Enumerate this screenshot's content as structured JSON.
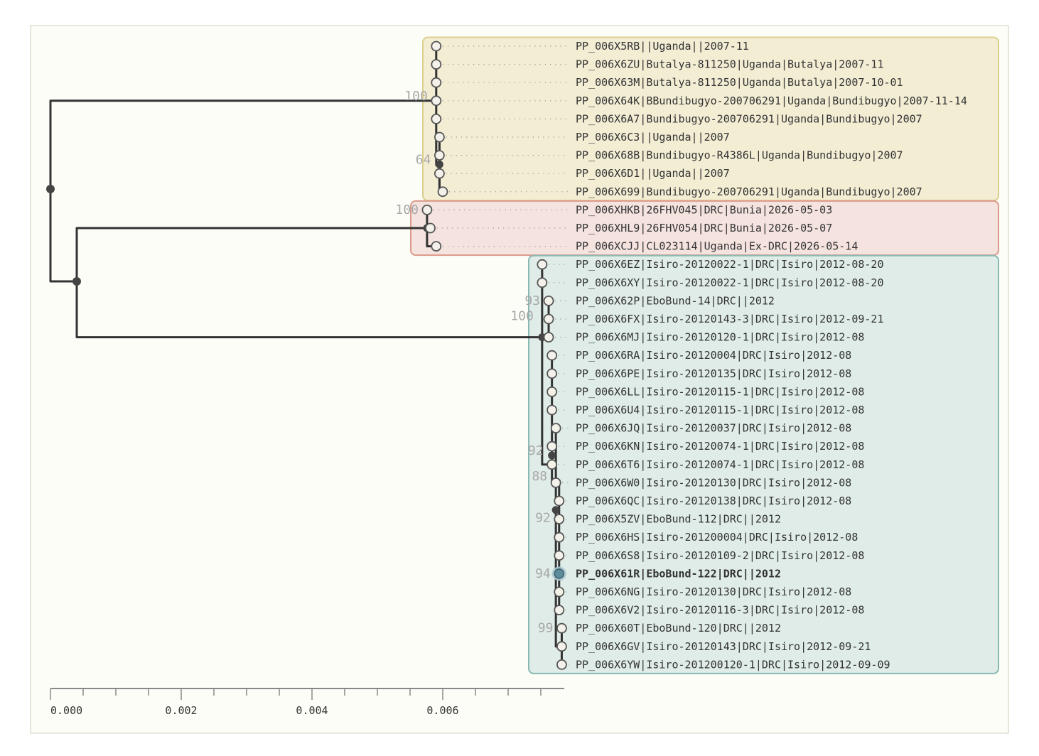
{
  "chart_data": {
    "type": "phylogenetic_tree",
    "axis": {
      "range": [
        0,
        0.0078
      ],
      "ticks": [
        {
          "value": 0.0,
          "label": "0.000"
        },
        {
          "value": 0.002,
          "label": "0.002"
        },
        {
          "value": 0.004,
          "label": "0.004"
        },
        {
          "value": 0.006,
          "label": "0.006"
        }
      ],
      "minor_step": 0.0005
    },
    "clades": [
      {
        "id": "uganda-2007",
        "color": "#f3edd4",
        "border": "#dccf8e"
      },
      {
        "id": "drc-2026",
        "color": "#f4e3df",
        "border": "#dc998a"
      },
      {
        "id": "drc-2012",
        "color": "#dfece8",
        "border": "#8ab8b2"
      }
    ],
    "tips": [
      {
        "label": "PP_006X5RB||Uganda||2007-11",
        "x": 0.0059
      },
      {
        "label": "PP_006X6ZU|Butalya-811250|Uganda|Butalya|2007-11",
        "x": 0.0059
      },
      {
        "label": "PP_006X63M|Butalya-811250|Uganda|Butalya|2007-10-01",
        "x": 0.0059
      },
      {
        "label": "PP_006X64K|BBundibugyo-200706291|Uganda|Bundibugyo|2007-11-14",
        "x": 0.0059
      },
      {
        "label": "PP_006X6A7|Bundibugyo-200706291|Uganda|Bundibugyo|2007",
        "x": 0.0059
      },
      {
        "label": "PP_006X6C3||Uganda||2007",
        "x": 0.00595
      },
      {
        "label": "PP_006X68B|Bundibugyo-R4386L|Uganda|Bundibugyo|2007",
        "x": 0.00595
      },
      {
        "label": "PP_006X6D1||Uganda||2007",
        "x": 0.00595
      },
      {
        "label": "PP_006X699|Bundibugyo-200706291|Uganda|Bundibugyo|2007",
        "x": 0.006
      },
      {
        "label": "PP_006XHKB|26FHV045|DRC|Bunia|2026-05-03",
        "x": 0.00576
      },
      {
        "label": "PP_006XHL9|26FHV054|DRC|Bunia|2026-05-07",
        "x": 0.00581
      },
      {
        "label": "PP_006XCJJ|CL023114|Uganda|Ex-DRC|2026-05-14",
        "x": 0.0059
      },
      {
        "label": "PP_006X6EZ|Isiro-20120022-1|DRC|Isiro|2012-08-20",
        "x": 0.00752
      },
      {
        "label": "PP_006X6XY|Isiro-20120022-1|DRC|Isiro|2012-08-20",
        "x": 0.00752
      },
      {
        "label": "PP_006X62P|EboBund-14|DRC||2012",
        "x": 0.00762
      },
      {
        "label": "PP_006X6FX|Isiro-20120143-3|DRC|Isiro|2012-09-21",
        "x": 0.00762
      },
      {
        "label": "PP_006X6MJ|Isiro-20120120-1|DRC|Isiro|2012-08",
        "x": 0.00762
      },
      {
        "label": "PP_006X6RA|Isiro-20120004|DRC|Isiro|2012-08",
        "x": 0.00767
      },
      {
        "label": "PP_006X6PE|Isiro-20120135|DRC|Isiro|2012-08",
        "x": 0.00767
      },
      {
        "label": "PP_006X6LL|Isiro-20120115-1|DRC|Isiro|2012-08",
        "x": 0.00767
      },
      {
        "label": "PP_006X6U4|Isiro-20120115-1|DRC|Isiro|2012-08",
        "x": 0.00767
      },
      {
        "label": "PP_006X6JQ|Isiro-20120037|DRC|Isiro|2012-08",
        "x": 0.00773
      },
      {
        "label": "PP_006X6KN|Isiro-20120074-1|DRC|Isiro|2012-08",
        "x": 0.00767
      },
      {
        "label": "PP_006X6T6|Isiro-20120074-1|DRC|Isiro|2012-08",
        "x": 0.00767
      },
      {
        "label": "PP_006X6W0|Isiro-20120130|DRC|Isiro|2012-08",
        "x": 0.00773
      },
      {
        "label": "PP_006X6QC|Isiro-20120138|DRC|Isiro|2012-08",
        "x": 0.00778
      },
      {
        "label": "PP_006X5ZV|EboBund-112|DRC||2012",
        "x": 0.00778
      },
      {
        "label": "PP_006X6HS|Isiro-201200004|DRC|Isiro|2012-08",
        "x": 0.00778
      },
      {
        "label": "PP_006X6S8|Isiro-20120109-2|DRC|Isiro|2012-08",
        "x": 0.00778
      },
      {
        "label": "PP_006X61R|EboBund-122|DRC||2012",
        "x": 0.00778,
        "highlight": true
      },
      {
        "label": "PP_006X6NG|Isiro-20120130|DRC|Isiro|2012-08",
        "x": 0.00778
      },
      {
        "label": "PP_006X6V2|Isiro-20120116-3|DRC|Isiro|2012-08",
        "x": 0.00778
      },
      {
        "label": "PP_006X60T|EboBund-120|DRC||2012",
        "x": 0.00782
      },
      {
        "label": "PP_006X6GV|Isiro-20120143|DRC|Isiro|2012-09-21",
        "x": 0.00782
      },
      {
        "label": "PP_006X6YW|Isiro-201200120-1|DRC|Isiro|2012-09-09",
        "x": 0.00782
      }
    ],
    "support_values": [
      {
        "label": "100",
        "x": 0.0059,
        "near_tip": 3
      },
      {
        "label": "64",
        "x": 0.00595,
        "near_tip": 6.5
      },
      {
        "label": "100",
        "x": 0.00576,
        "near_tip": 9.25
      },
      {
        "label": "93",
        "x": 0.00762,
        "near_tip": 14.25
      },
      {
        "label": "100",
        "x": 0.00752,
        "near_tip": 15.1
      },
      {
        "label": "92",
        "x": 0.00767,
        "near_tip": 22.5
      },
      {
        "label": "88",
        "x": 0.00773,
        "near_tip": 23.9
      },
      {
        "label": "92",
        "x": 0.00778,
        "near_tip": 26.2
      },
      {
        "label": "94",
        "x": 0.00778,
        "near_tip": 29.25
      },
      {
        "label": "99",
        "x": 0.00782,
        "near_tip": 32.25
      }
    ],
    "colors": {
      "branch": "#333333",
      "node": "#444444",
      "tip_fill": "#f3f1ea",
      "highlight_fill": "#5e8c9a",
      "highlight_ring": "#a9c6cf",
      "support": "#a8a8a8"
    }
  }
}
